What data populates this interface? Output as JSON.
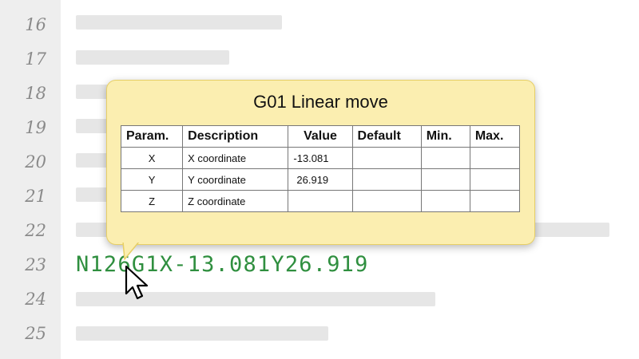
{
  "editor": {
    "line_numbers": [
      "16",
      "17",
      "18",
      "19",
      "20",
      "21",
      "22",
      "23",
      "24",
      "25"
    ],
    "active_line_code": "N126G1X-13.081Y26.919"
  },
  "tooltip": {
    "title": "G01 Linear move",
    "headers": [
      "Param.",
      "Description",
      "Value",
      "Default",
      "Min.",
      "Max."
    ],
    "rows": [
      {
        "param": "X",
        "description": "X coordinate",
        "value": "-13.081",
        "default": "",
        "min": "",
        "max": ""
      },
      {
        "param": "Y",
        "description": "Y coordinate",
        "value": "26.919",
        "default": "",
        "min": "",
        "max": ""
      },
      {
        "param": "Z",
        "description": "Z coordinate",
        "value": "",
        "default": "",
        "min": "",
        "max": ""
      }
    ]
  },
  "colors": {
    "code_text": "#2f8f3f",
    "tooltip_background": "#fbeeb0",
    "tooltip_border": "#e7cf66",
    "gutter_background": "#eeeeee"
  },
  "icons": {
    "cursor": "mouse-pointer-icon"
  }
}
